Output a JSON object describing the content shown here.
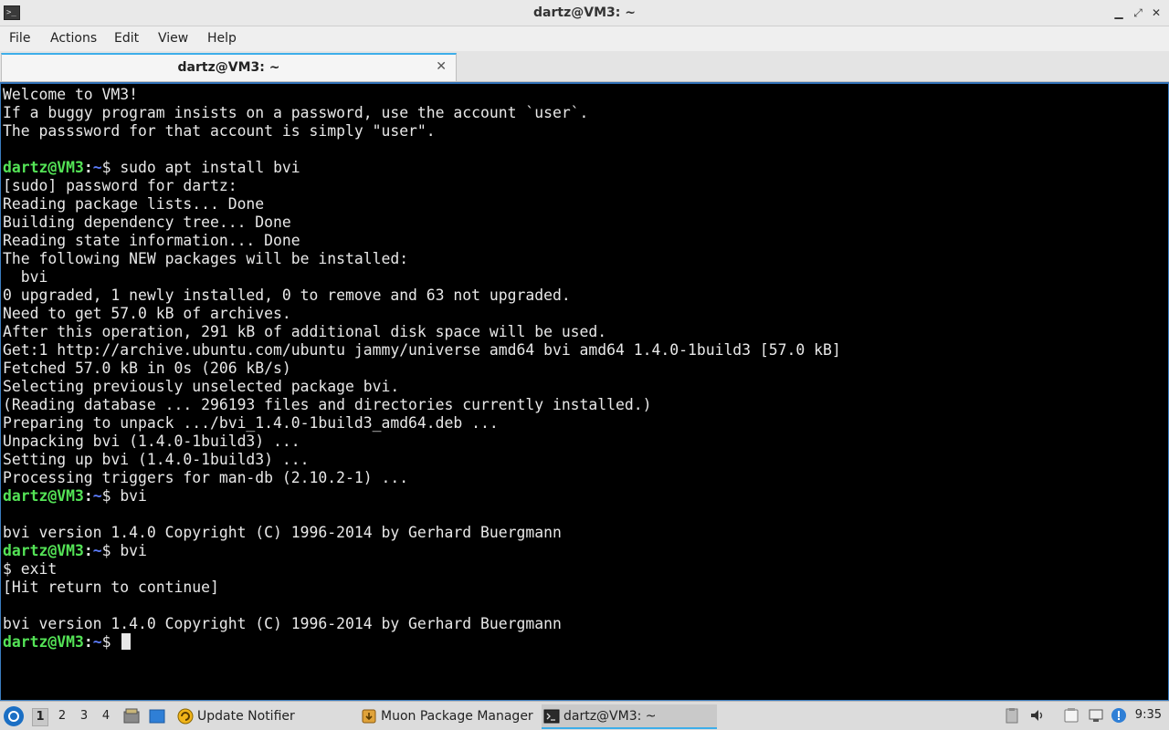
{
  "window": {
    "title": "dartz@VM3: ~",
    "app_icon_glyph": ">_",
    "controls": {
      "minimize": "▁",
      "maximize": "⤢",
      "close": "✕"
    }
  },
  "menu": {
    "items": [
      "File",
      "Actions",
      "Edit",
      "View",
      "Help"
    ]
  },
  "tabs": [
    {
      "label": "dartz@VM3: ~",
      "close": "✕"
    }
  ],
  "prompt": {
    "user": "dartz@VM3",
    "sep": ":",
    "path": "~",
    "symbol": "$ "
  },
  "terminal": {
    "lines": [
      {
        "text": "Welcome to VM3!"
      },
      {
        "text": "If a buggy program insists on a password, use the account `user`."
      },
      {
        "text": "The passsword for that account is simply \"user\"."
      },
      {
        "text": ""
      },
      {
        "prompt": true,
        "text": "sudo apt install bvi"
      },
      {
        "text": "[sudo] password for dartz:"
      },
      {
        "text": "Reading package lists... Done"
      },
      {
        "text": "Building dependency tree... Done"
      },
      {
        "text": "Reading state information... Done"
      },
      {
        "text": "The following NEW packages will be installed:"
      },
      {
        "text": "  bvi"
      },
      {
        "text": "0 upgraded, 1 newly installed, 0 to remove and 63 not upgraded."
      },
      {
        "text": "Need to get 57.0 kB of archives."
      },
      {
        "text": "After this operation, 291 kB of additional disk space will be used."
      },
      {
        "text": "Get:1 http://archive.ubuntu.com/ubuntu jammy/universe amd64 bvi amd64 1.4.0-1build3 [57.0 kB]"
      },
      {
        "text": "Fetched 57.0 kB in 0s (206 kB/s)"
      },
      {
        "text": "Selecting previously unselected package bvi."
      },
      {
        "text": "(Reading database ... 296193 files and directories currently installed.)"
      },
      {
        "text": "Preparing to unpack .../bvi_1.4.0-1build3_amd64.deb ..."
      },
      {
        "text": "Unpacking bvi (1.4.0-1build3) ..."
      },
      {
        "text": "Setting up bvi (1.4.0-1build3) ..."
      },
      {
        "text": "Processing triggers for man-db (2.10.2-1) ..."
      },
      {
        "prompt": true,
        "text": "bvi"
      },
      {
        "text": ""
      },
      {
        "text": "bvi version 1.4.0 Copyright (C) 1996-2014 by Gerhard Buergmann"
      },
      {
        "prompt": true,
        "text": "bvi"
      },
      {
        "text": "$ exit"
      },
      {
        "text": "[Hit return to continue]"
      },
      {
        "text": ""
      },
      {
        "text": "bvi version 1.4.0 Copyright (C) 1996-2014 by Gerhard Buergmann"
      },
      {
        "prompt": true,
        "text": "",
        "cursor": true
      }
    ]
  },
  "taskbar": {
    "desktops": [
      "1",
      "2",
      "3",
      "4"
    ],
    "active_desktop": "1",
    "tasks": [
      {
        "label": "Update Notifier",
        "icon": "update-notifier-icon"
      },
      {
        "label": "Muon Package Manager",
        "icon": "package-icon"
      },
      {
        "label": "dartz@VM3: ~",
        "icon": "terminal-icon"
      }
    ],
    "clock": "9:35"
  },
  "colors": {
    "prompt_user": "#54e356",
    "prompt_path": "#5c7cfa",
    "terminal_bg": "#000000",
    "terminal_fg": "#e8e8e8",
    "accent": "#3daee9"
  }
}
